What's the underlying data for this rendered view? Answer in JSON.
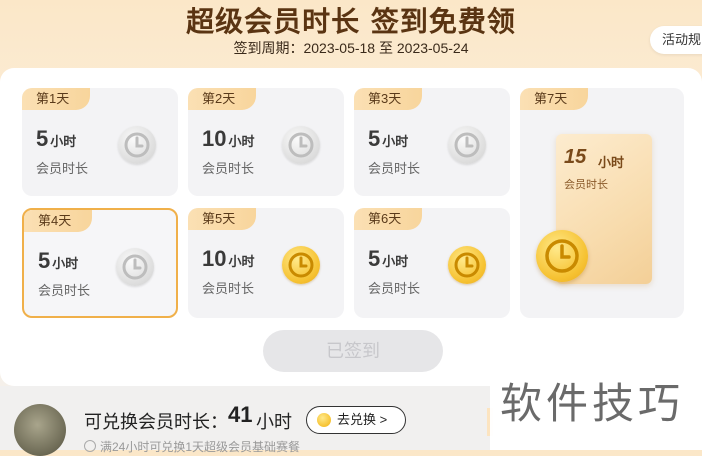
{
  "header": {
    "title": "超级会员时长 签到免费领",
    "period": "签到周期：2023-05-18 至 2023-05-24",
    "rules_label": "活动规"
  },
  "days": [
    {
      "label": "第1天",
      "amount": "5",
      "unit": "小时",
      "sub": "会员时长",
      "coin": "gray"
    },
    {
      "label": "第2天",
      "amount": "10",
      "unit": "小时",
      "sub": "会员时长",
      "coin": "gray"
    },
    {
      "label": "第3天",
      "amount": "5",
      "unit": "小时",
      "sub": "会员时长",
      "coin": "gray"
    },
    {
      "label": "第4天",
      "amount": "5",
      "unit": "小时",
      "sub": "会员时长",
      "coin": "gray"
    },
    {
      "label": "第5天",
      "amount": "10",
      "unit": "小时",
      "sub": "会员时长",
      "coin": "gold"
    },
    {
      "label": "第6天",
      "amount": "5",
      "unit": "小时",
      "sub": "会员时长",
      "coin": "gold"
    },
    {
      "label": "第7天",
      "amount": "15",
      "unit": "小时",
      "sub": "会员时长",
      "coin": "gold"
    }
  ],
  "signed_button": "已签到",
  "footer": {
    "redeem_label": "可兑换会员时长：",
    "redeem_value": "41",
    "redeem_unit": "小时",
    "redeem_button": "去兑换 >",
    "hint": "满24小时可兑换1天超级会员基础赛餐"
  },
  "watermark": "软件技巧"
}
